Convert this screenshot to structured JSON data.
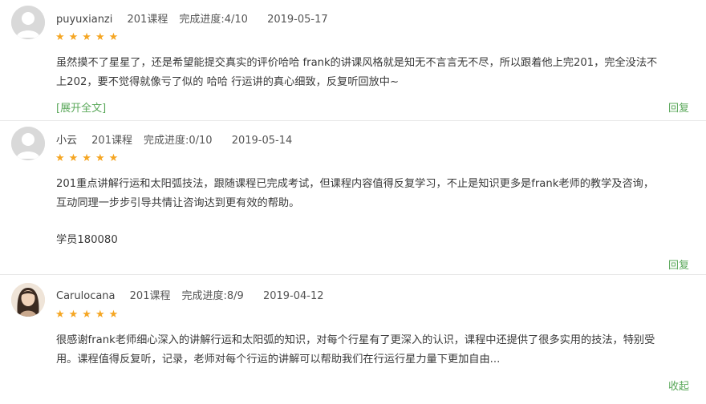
{
  "comments": [
    {
      "user": "puyuxianzi",
      "course": "201课程",
      "progress": "完成进度:4/10",
      "date": "2019-05-17",
      "rating": "★★★★★",
      "line1": "虽然摸不了星星了，还是希望能提交真实的评价哈哈 frank的讲课风格就是知无不言言无不尽，所以跟着他上完201，完全没法不",
      "line2": "上202，要不觉得就像亏了似的 哈哈 行运讲的真心细致，反复听回放中~",
      "expand_label": "[展开全文]",
      "action_label": "回复"
    },
    {
      "user": "小云",
      "course": "201课程",
      "progress": "完成进度:0/10",
      "date": "2019-05-14",
      "rating": "★★★★★",
      "line1": "201重点讲解行运和太阳弧技法，跟随课程已完成考试，但课程内容值得反复学习，不止是知识更多是frank老师的教学及咨询，",
      "line2": "互动同理一步步引导共情让咨询达到更有效的帮助。",
      "signature": "学员180080",
      "action_label": "回复"
    },
    {
      "user": "Carulocana",
      "course": "201课程",
      "progress": "完成进度:8/9",
      "date": "2019-04-12",
      "rating": "★★★★★",
      "line1": "很感谢frank老师细心深入的讲解行运和太阳弧的知识，对每个行星有了更深入的认识，课程中还提供了很多实用的技法，特别受",
      "line2": "用。课程值得反复听，记录，老师对每个行运的讲解可以帮助我们在行运行星力量下更加自由...",
      "action_label": "收起"
    }
  ],
  "colors": {
    "accent": "#5aa85a",
    "star": "#f5a623",
    "avatar": "#d9d9d9"
  },
  "icons": [
    "default-avatar-icon",
    "user-photo-avatar",
    "star-icon"
  ]
}
